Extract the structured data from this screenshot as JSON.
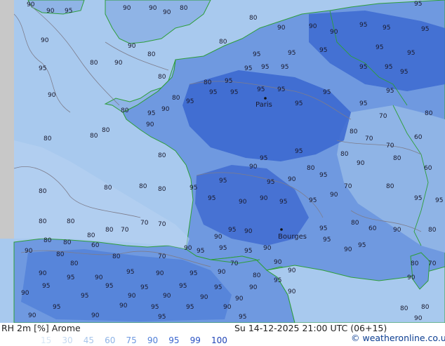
{
  "footer": {
    "title": "RH 2m [%] Arome",
    "valid_time": "Su 14-12-2025 21:00 UTC (06+15)",
    "credit": "© weatheronline.co.uk"
  },
  "legend": [
    {
      "label": "15",
      "color": "#d7e6f5"
    },
    {
      "label": "30",
      "color": "#c3d8f0"
    },
    {
      "label": "45",
      "color": "#a9c6ea"
    },
    {
      "label": "60",
      "color": "#8fb4e6"
    },
    {
      "label": "75",
      "color": "#6f99e0"
    },
    {
      "label": "90",
      "color": "#4f7fd8"
    },
    {
      "label": "95",
      "color": "#3a66cf"
    },
    {
      "label": "99",
      "color": "#2a52c4"
    },
    {
      "label": "100",
      "color": "#1f43b6"
    }
  ],
  "colors": {
    "sea": "#a8c9ee",
    "land_low": "#8fb4e6",
    "land_high": "#5b86dc",
    "land_very_high": "#3d68d2",
    "coast": "#2e9e3a",
    "contour": "#7d7d8c"
  },
  "cities": [
    {
      "name": "Paris"
    },
    {
      "name": "Bourges"
    }
  ],
  "contour_labels": [
    "90",
    "90",
    "95",
    "90",
    "80",
    "80",
    "95",
    "90",
    "90",
    "90",
    "80",
    "90",
    "95",
    "90",
    "95",
    "90",
    "90",
    "95",
    "95",
    "95",
    "90",
    "90",
    "80",
    "80",
    "95",
    "95",
    "90",
    "95",
    "95",
    "80",
    "80",
    "95",
    "95",
    "95",
    "95",
    "90",
    "95",
    "95",
    "90",
    "95",
    "95",
    "95",
    "90",
    "80",
    "80",
    "80",
    "80",
    "90",
    "95",
    "95",
    "95",
    "95",
    "90",
    "80",
    "90",
    "80",
    "80",
    "80",
    "95",
    "95",
    "90",
    "95",
    "90",
    "90",
    "90",
    "80",
    "80",
    "80",
    "80",
    "95",
    "95",
    "95",
    "95",
    "95",
    "90",
    "90",
    "90",
    "80",
    "80",
    "80",
    "70",
    "80",
    "80",
    "95",
    "95",
    "90",
    "95",
    "95",
    "95",
    "95",
    "90",
    "90",
    "90",
    "80",
    "80",
    "95",
    "95",
    "90",
    "95",
    "95",
    "90",
    "90",
    "90"
  ]
}
